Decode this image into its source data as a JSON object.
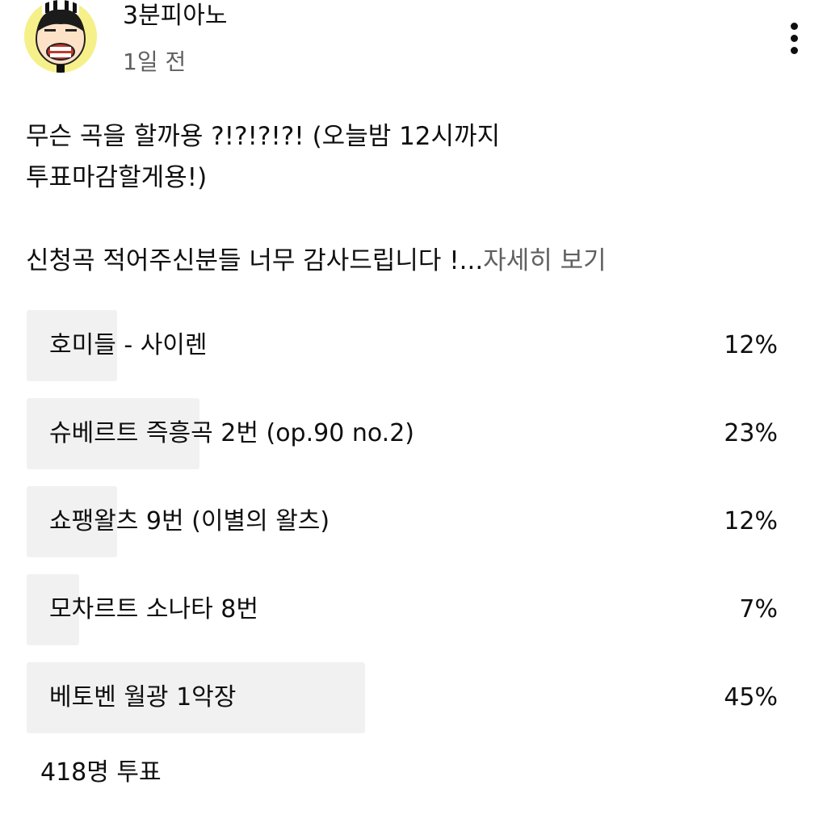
{
  "post": {
    "author": "3분피아노",
    "time": "1일 전",
    "avatar_icon": "cartoon-pianist-avatar",
    "menu_icon": "more-vertical-icon",
    "text_line_1": "무슨 곡을 할까용 ?!?!?!?! (오늘밤 12시까지",
    "text_line_2": "투표마감할게용!)",
    "text_line_3": "신청곡 적어주신분들 너무 감사드립니다 !...",
    "read_more": "자세히 보기"
  },
  "poll": {
    "options": [
      {
        "label": "호미들 - 사이렌",
        "percent_text": "12%",
        "percent": 12
      },
      {
        "label": "슈베르트 즉흥곡 2번 (op.90 no.2)",
        "percent_text": "23%",
        "percent": 23
      },
      {
        "label": "쇼팽왈츠 9번 (이별의 왈츠)",
        "percent_text": "12%",
        "percent": 12
      },
      {
        "label": "모차르트 소나타 8번",
        "percent_text": "7%",
        "percent": 7
      },
      {
        "label": "베토벤 월광 1악장",
        "percent_text": "45%",
        "percent": 45
      }
    ],
    "vote_count": "418명 투표"
  },
  "colors": {
    "bar": "#f1f1f1",
    "text": "#0f0f0f",
    "secondary_text": "#606060"
  }
}
